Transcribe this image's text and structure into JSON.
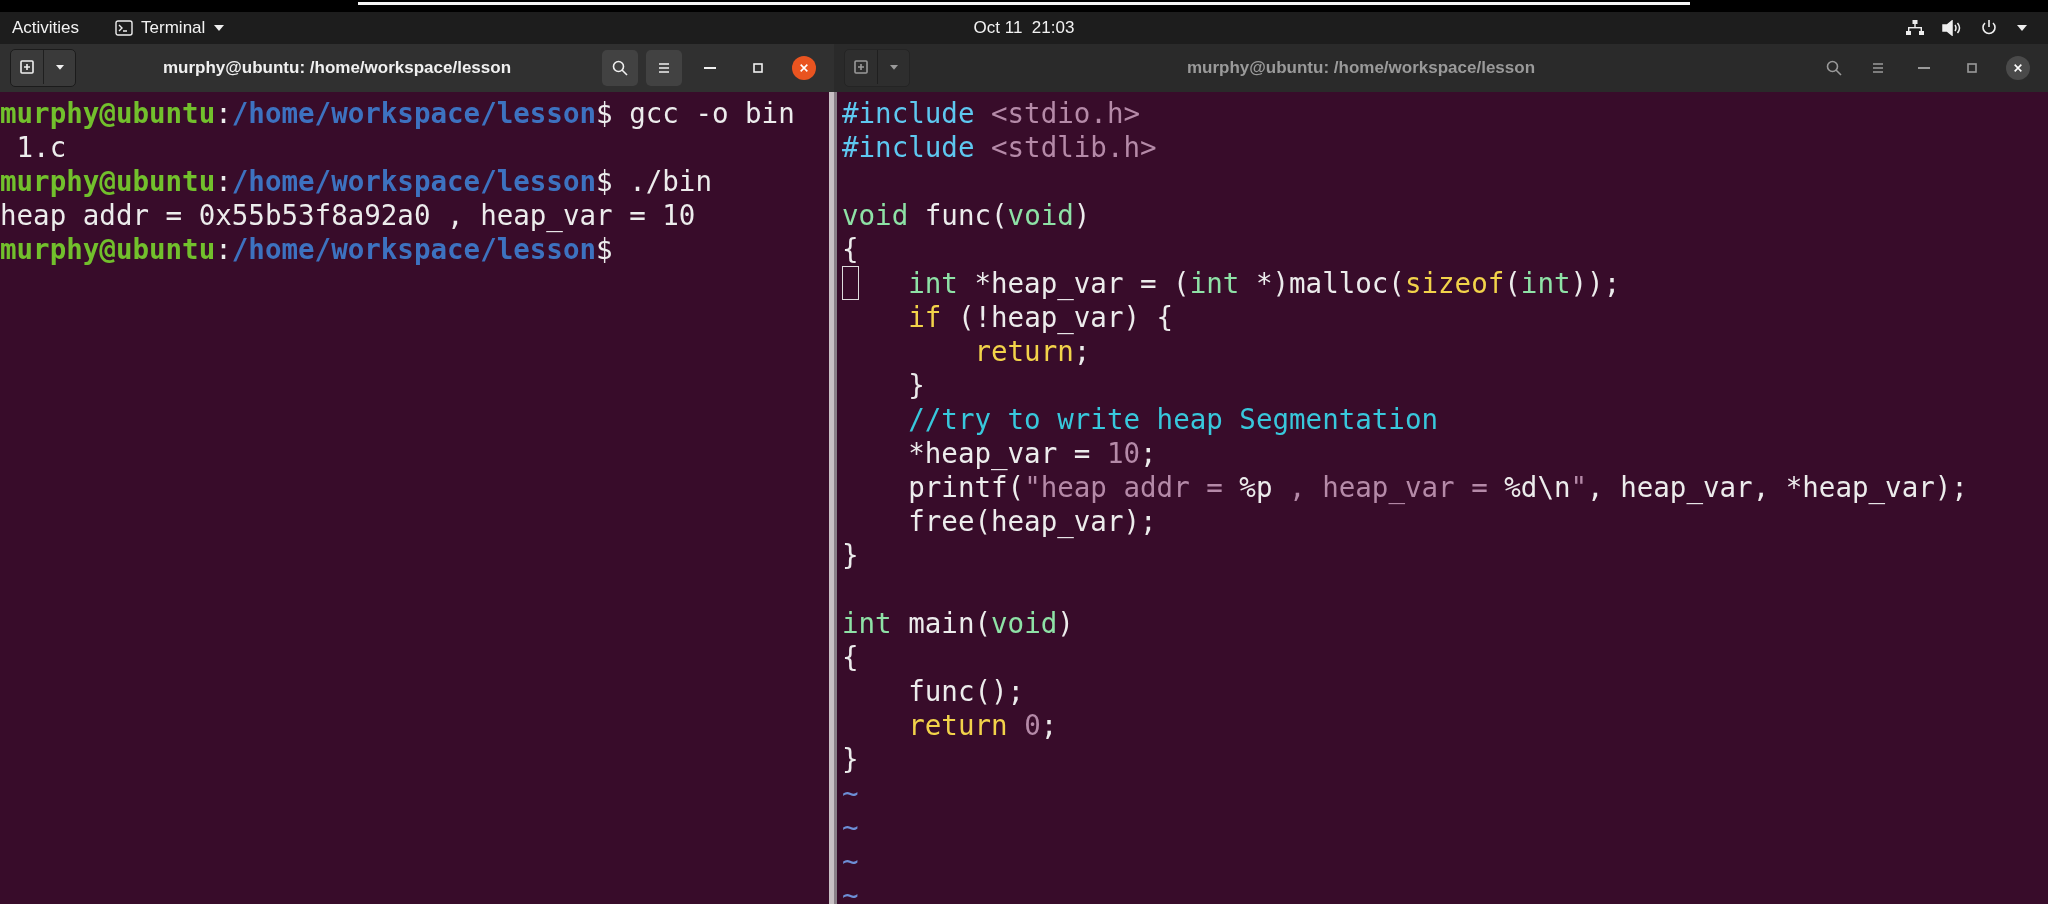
{
  "top_bar": {
    "activities": "Activities",
    "app_menu": "Terminal",
    "clock": "Oct 11  21:03"
  },
  "windows": [
    {
      "title": "murphy@ubuntu: /home/workspace/lesson",
      "focused": true,
      "lines": [
        {
          "segments": [
            {
              "kind": "user",
              "text": "murphy@ubuntu"
            },
            {
              "kind": "plain",
              "text": ":"
            },
            {
              "kind": "path",
              "text": "/home/workspace/lesson"
            },
            {
              "kind": "plain",
              "text": "$ gcc -o bin"
            }
          ]
        },
        {
          "segments": [
            {
              "kind": "plain",
              "text": " 1.c"
            }
          ]
        },
        {
          "segments": [
            {
              "kind": "user",
              "text": "murphy@ubuntu"
            },
            {
              "kind": "plain",
              "text": ":"
            },
            {
              "kind": "path",
              "text": "/home/workspace/lesson"
            },
            {
              "kind": "plain",
              "text": "$ ./bin"
            }
          ]
        },
        {
          "segments": [
            {
              "kind": "plain",
              "text": "heap addr = 0x55b53f8a92a0 , heap_var = 10"
            }
          ]
        },
        {
          "segments": [
            {
              "kind": "user",
              "text": "murphy@ubuntu"
            },
            {
              "kind": "plain",
              "text": ":"
            },
            {
              "kind": "path",
              "text": "/home/workspace/lesson"
            },
            {
              "kind": "plain",
              "text": "$"
            }
          ]
        }
      ]
    },
    {
      "title": "murphy@ubuntu: /home/workspace/lesson",
      "focused": false,
      "lines": [
        {
          "segments": [
            {
              "kind": "preproc",
              "text": "#include"
            },
            {
              "kind": "string",
              "text": " <stdio.h>"
            }
          ]
        },
        {
          "segments": [
            {
              "kind": "preproc",
              "text": "#include"
            },
            {
              "kind": "string",
              "text": " <stdlib.h>"
            }
          ]
        },
        {
          "blank_before": true,
          "segments": [
            {
              "kind": "type",
              "text": "void"
            },
            {
              "kind": "plain",
              "text": " func("
            },
            {
              "kind": "type",
              "text": "void"
            },
            {
              "kind": "plain",
              "text": ")"
            }
          ]
        },
        {
          "segments": [
            {
              "kind": "plain",
              "text": "{"
            }
          ]
        },
        {
          "segments": [
            {
              "kind": "cursor"
            },
            {
              "kind": "type",
              "text": "   int"
            },
            {
              "kind": "plain",
              "text": " *heap_var = ("
            },
            {
              "kind": "type",
              "text": "int"
            },
            {
              "kind": "plain",
              "text": " *)malloc("
            },
            {
              "kind": "keyword",
              "text": "sizeof"
            },
            {
              "kind": "plain",
              "text": "("
            },
            {
              "kind": "type",
              "text": "int"
            },
            {
              "kind": "plain",
              "text": "));"
            }
          ]
        },
        {
          "segments": [
            {
              "kind": "keyword",
              "text": "    if"
            },
            {
              "kind": "plain",
              "text": " (!heap_var) {"
            }
          ]
        },
        {
          "segments": [
            {
              "kind": "keyword",
              "text": "        return"
            },
            {
              "kind": "plain",
              "text": ";"
            }
          ]
        },
        {
          "segments": [
            {
              "kind": "plain",
              "text": "    }"
            }
          ]
        },
        {
          "segments": [
            {
              "kind": "comment",
              "text": "    //try to write heap Segmentation"
            }
          ]
        },
        {
          "segments": [
            {
              "kind": "plain",
              "text": "    *heap_var = "
            },
            {
              "kind": "number",
              "text": "10"
            },
            {
              "kind": "plain",
              "text": ";"
            }
          ]
        },
        {
          "segments": [
            {
              "kind": "plain",
              "text": "    printf("
            },
            {
              "kind": "string",
              "text": "\"heap addr = "
            },
            {
              "kind": "plain",
              "text": "%p"
            },
            {
              "kind": "string",
              "text": " , heap_var = "
            },
            {
              "kind": "plain",
              "text": "%d\\n"
            },
            {
              "kind": "string",
              "text": "\""
            },
            {
              "kind": "plain",
              "text": ", heap_var, *heap_var);"
            }
          ]
        },
        {
          "segments": [
            {
              "kind": "plain",
              "text": "    free(heap_var);"
            }
          ]
        },
        {
          "segments": [
            {
              "kind": "plain",
              "text": "}"
            }
          ]
        },
        {
          "blank_before": true,
          "segments": [
            {
              "kind": "type",
              "text": "int"
            },
            {
              "kind": "plain",
              "text": " main("
            },
            {
              "kind": "type",
              "text": "void"
            },
            {
              "kind": "plain",
              "text": ")"
            }
          ]
        },
        {
          "segments": [
            {
              "kind": "plain",
              "text": "{"
            }
          ]
        },
        {
          "segments": [
            {
              "kind": "plain",
              "text": "    func();"
            }
          ]
        },
        {
          "segments": [
            {
              "kind": "keyword",
              "text": "    return"
            },
            {
              "kind": "number",
              "text": " 0"
            },
            {
              "kind": "plain",
              "text": ";"
            }
          ]
        },
        {
          "segments": [
            {
              "kind": "plain",
              "text": "}"
            }
          ]
        },
        {
          "segments": [
            {
              "kind": "tilde",
              "text": "~"
            }
          ]
        },
        {
          "segments": [
            {
              "kind": "tilde",
              "text": "~"
            }
          ]
        },
        {
          "segments": [
            {
              "kind": "tilde",
              "text": "~"
            }
          ]
        },
        {
          "segments": [
            {
              "kind": "tilde",
              "text": "~"
            }
          ]
        }
      ]
    }
  ]
}
